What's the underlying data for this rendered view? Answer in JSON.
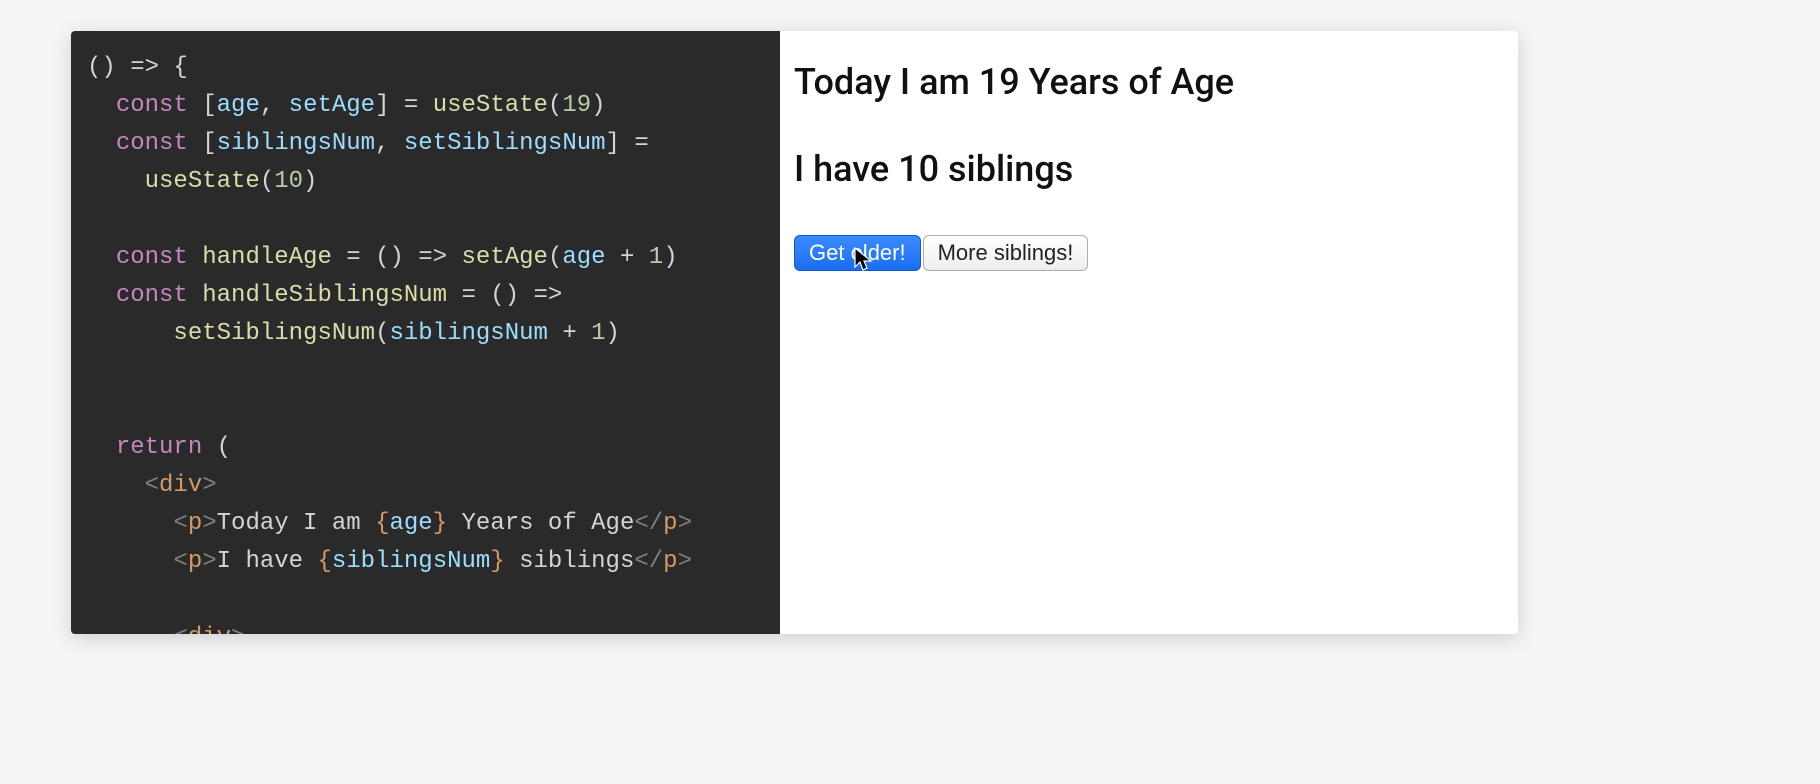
{
  "code": {
    "initial_age": "19",
    "initial_siblings": "10",
    "tokens": {
      "const": "const",
      "return": "return",
      "useState": "useState",
      "setAge": "setAge",
      "age": "age",
      "siblingsNum": "siblingsNum",
      "setSiblingsNum": "setSiblingsNum",
      "handleAge": "handleAge",
      "handleSiblingsNum": "handleSiblingsNum",
      "one": "1",
      "div": "div",
      "p": "p",
      "text_age_1": "Today I am ",
      "text_age_2": " Years of Age",
      "text_sib_1": "I have ",
      "text_sib_2": " siblings"
    }
  },
  "preview": {
    "age_line": "Today I am 19 Years of Age",
    "siblings_line": "I have 10 siblings",
    "get_older_label": "Get older!",
    "more_siblings_label": "More siblings!"
  },
  "cursor": {
    "name": "cursor-pointer"
  }
}
